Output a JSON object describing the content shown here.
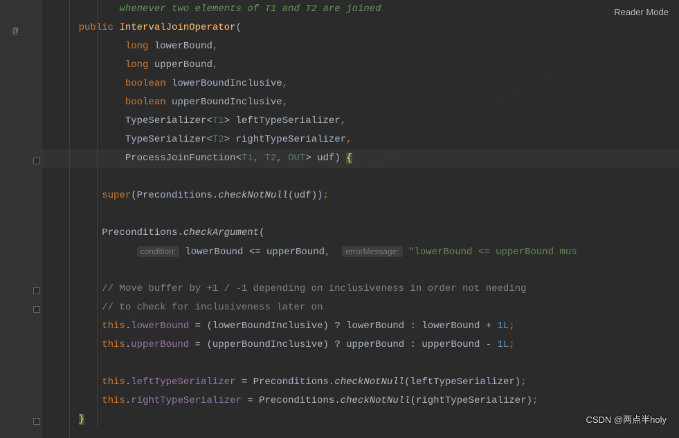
{
  "reader_mode": "Reader Mode",
  "at_symbol": "@",
  "doc_line": "whenever two elements of T1 and T2 are joined",
  "kw": {
    "public": "public",
    "long": "long",
    "boolean": "boolean",
    "super": "super",
    "this": "this"
  },
  "ctor_name": "IntervalJoinOperator",
  "params": {
    "lowerBound": "lowerBound",
    "upperBound": "upperBound",
    "lowerBoundInclusive": "lowerBoundInclusive",
    "upperBoundInclusive": "upperBoundInclusive",
    "leftTypeSerializer": "leftTypeSerializer",
    "rightTypeSerializer": "rightTypeSerializer",
    "udf": "udf"
  },
  "types": {
    "TypeSerializer": "TypeSerializer",
    "ProcessJoinFunction": "ProcessJoinFunction",
    "T1": "T1",
    "T2": "T2",
    "OUT": "OUT"
  },
  "methods": {
    "checkNotNull": "checkNotNull",
    "checkArgument": "checkArgument"
  },
  "classes": {
    "Preconditions": "Preconditions"
  },
  "hints": {
    "condition": "condition:",
    "errorMessage": "errorMessage:"
  },
  "expr": {
    "lte": "lowerBound <= upperBound",
    "str": "\"lowerBound <= upperBound mus",
    "lowerAssign": "lowerBound",
    "upperAssign": "upperBound",
    "leftSer": "leftTypeSerializer",
    "rightSer": "rightTypeSerializer",
    "oneL": "1L"
  },
  "comments": {
    "c1": "// Move buffer by +1 / -1 depending on inclusiveness in order not needing",
    "c2": "// to check for inclusiveness later on"
  },
  "watermark_main": "CSDN @两点半holy",
  "watermark_diag": "90506288-2023-04-23-19:03"
}
